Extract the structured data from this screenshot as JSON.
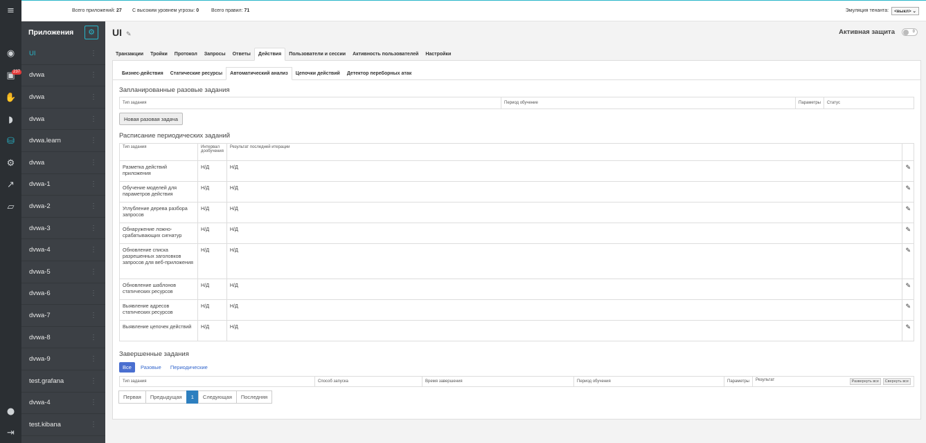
{
  "topbar": {
    "total_apps_label": "Всего приложений:",
    "total_apps_value": "27",
    "high_threat_label": "С высоким уровнем угрозы:",
    "high_threat_value": "0",
    "total_rules_label": "Всего правил:",
    "total_rules_value": "71",
    "tenant_emulation_label": "Эмуляция тенанта:",
    "tenant_emulation_value": "<выкл>"
  },
  "rail": {
    "badge": "237",
    "icons": [
      "menu-icon",
      "eye-icon",
      "alerts-icon",
      "hand-icon",
      "signal-icon",
      "database-icon",
      "gear-icon",
      "chart-icon",
      "graduation-icon",
      "user-icon",
      "logout-icon"
    ]
  },
  "apps": {
    "title": "Приложения",
    "items": [
      "UI",
      "dvwa",
      "dvwa",
      "dvwa",
      "dvwa.learn",
      "dvwa",
      "dvwa-1",
      "dvwa-2",
      "dvwa-3",
      "dvwa-4",
      "dvwa-5",
      "dvwa-6",
      "dvwa-7",
      "dvwa-8",
      "dvwa-9",
      "test.grafana",
      "dvwa-4",
      "test.kibana"
    ]
  },
  "main": {
    "title": "UI",
    "active_protection": "Активная защита",
    "tabs": [
      "Транзакции",
      "Тройки",
      "Протокол",
      "Запросы",
      "Ответы",
      "Действия",
      "Пользователи и сессии",
      "Активность пользователей",
      "Настройки"
    ],
    "subtabs": [
      "Бизнес-действия",
      "Статические ресурсы",
      "Автоматический анализ",
      "Цепочки действий",
      "Детектор переборных атак"
    ],
    "scheduled_once": {
      "title": "Запланированные разовые задания",
      "cols": [
        "Тип задания",
        "Период обучение",
        "Параметры",
        "Статус"
      ],
      "new_button": "Новая разовая задача"
    },
    "periodic": {
      "title": "Расписание периодических заданий",
      "cols": [
        "Тип задания",
        "Интервал дообучения",
        "Результат последней итерации"
      ],
      "rows": [
        {
          "name": "Разметка действий приложения",
          "interval": "Н/Д",
          "result": "Н/Д"
        },
        {
          "name": "Обучение моделей для параметров действия",
          "interval": "Н/Д",
          "result": "Н/Д"
        },
        {
          "name": "Углубление дерева разбора запросов",
          "interval": "Н/Д",
          "result": "Н/Д"
        },
        {
          "name": "Обнаружение ложно-срабатывающих сигнатур",
          "interval": "Н/Д",
          "result": "Н/Д"
        },
        {
          "name": "Обновление списка разрешенных заголовков запросов для веб-приложения",
          "interval": "Н/Д",
          "result": "Н/Д"
        },
        {
          "name": "Обновление шаблонов статических ресурсов",
          "interval": "Н/Д",
          "result": "Н/Д"
        },
        {
          "name": "Выявление адресов статических ресурсов",
          "interval": "Н/Д",
          "result": "Н/Д"
        },
        {
          "name": "Выявление цепочек действий",
          "interval": "Н/Д",
          "result": "Н/Д"
        }
      ]
    },
    "completed": {
      "title": "Завершенные задания",
      "filters": [
        "Все",
        "Разовые",
        "Периодические"
      ],
      "cols": [
        "Тип задания",
        "Способ запуска",
        "Время завершения",
        "Период обучения",
        "Параметры",
        "Результат"
      ],
      "expand_all": "Развернуть все",
      "collapse_all": "Свернуть все",
      "pager": [
        "Первая",
        "Предыдущая",
        "1",
        "Следующая",
        "Последняя"
      ]
    }
  }
}
